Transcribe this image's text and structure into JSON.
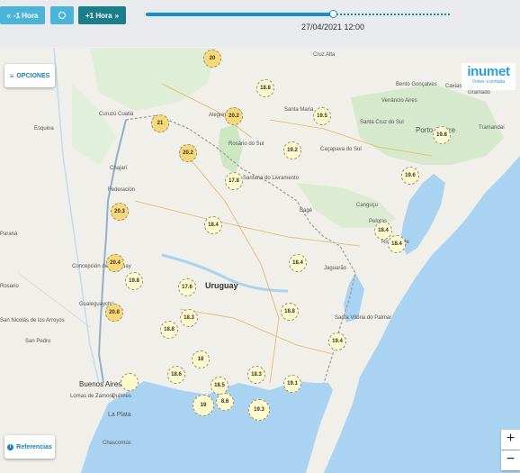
{
  "controls": {
    "back_label": "-1 Hora",
    "forward_label": "+1 Hora",
    "datetime": "27/04/2021 12:00",
    "back_icon": "double-chevron-left-icon",
    "forward_icon": "double-chevron-right-icon",
    "now_icon": "target-icon"
  },
  "options_label": "OPCIONES",
  "references_label": "Referencias",
  "brand": {
    "name": "inumet",
    "back_link": "Volver a portada"
  },
  "zoom": {
    "in": "+",
    "out": "−"
  },
  "colors": {
    "water": "#a9d3f1",
    "warm_marker": "#f7d977",
    "cool_marker": "#fefacb",
    "accent": "#1c8fc3"
  },
  "stations": [
    "20",
    "18.8",
    "21",
    "20.2",
    "19.5",
    "20.2",
    "19.2",
    "19.8",
    "17.8",
    "19.6",
    "20.3",
    "18.4",
    "18.4",
    "18.4",
    "20.4",
    "18.4",
    "19.8",
    "17.6",
    "20.8",
    "18.3",
    "18.8",
    "18.8",
    "19.4",
    "18",
    "18.6",
    "18.3",
    "18.5",
    "19.1",
    "19",
    "8.6",
    "19.3"
  ],
  "places": {
    "uruguay": "Uruguay",
    "alegrete": "Alegrete",
    "santana": "Santana do Livramento",
    "bage": "Bagé",
    "cruz_alta": "Cruz Alta",
    "santa_maria": "Santa Maria",
    "santa_cruz": "Santa Cruz do Sul",
    "caxias": "Caxias",
    "goncalves": "Bento Gonçalves",
    "venancio": "Venâncio Aires",
    "gramado": "Gramado",
    "porto": "Porto Alegre",
    "tramandai": "Tramandaí",
    "rosario": "Rosário do Sul",
    "cacapava": "Caçapava do Sul",
    "cangucu": "Canguçu",
    "pelotas": "Pelotas",
    "rio_grande": "Rio Grande",
    "jaguarao": "Jaguarão",
    "santa_vitoria": "Santa Vitória do Palmar",
    "concepcion": "Concepción del Uruguay",
    "gualeguaychu": "Gualeguaychú",
    "buenos_aires": "Buenos Aires",
    "quilmes": "Quilmes",
    "lomas": "Lomas de Zamora",
    "la_plata": "La Plata",
    "san_nicolas": "San Nicolás de los Arroyos",
    "san_pedro": "San Pedro",
    "chascomus": "Chascomús",
    "federacion": "Federación",
    "chajari": "Chajarí",
    "curuzu": "Curuzú Cuatiá",
    "esquina": "Esquina",
    "parana": "Paraná",
    "rosario_ar": "Rosario"
  }
}
